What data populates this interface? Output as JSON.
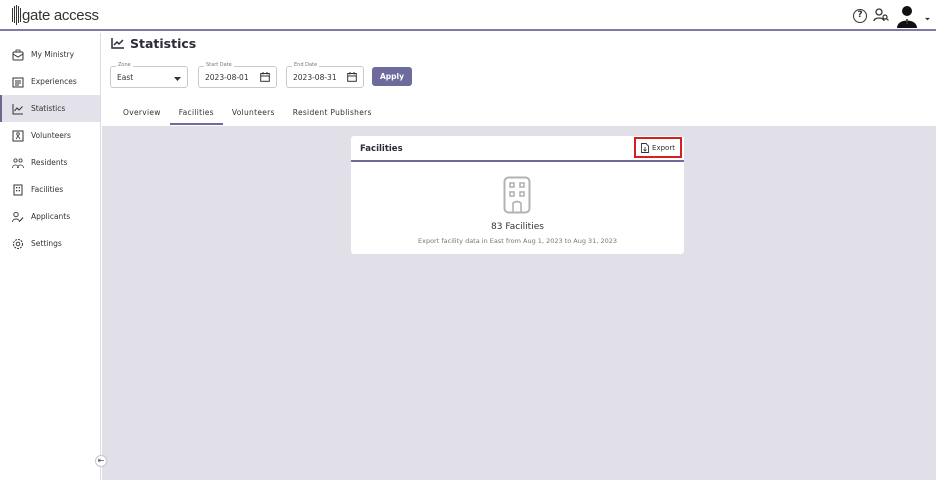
{
  "app": {
    "logo_text": "gate access"
  },
  "sidebar": {
    "items": [
      {
        "label": "My Ministry",
        "icon": "ministry-icon"
      },
      {
        "label": "Experiences",
        "icon": "experiences-icon"
      },
      {
        "label": "Statistics",
        "icon": "statistics-icon",
        "active": true
      },
      {
        "label": "Volunteers",
        "icon": "volunteers-icon"
      },
      {
        "label": "Residents",
        "icon": "residents-icon"
      },
      {
        "label": "Facilities",
        "icon": "facilities-icon"
      },
      {
        "label": "Applicants",
        "icon": "applicants-icon"
      },
      {
        "label": "Settings",
        "icon": "settings-icon"
      }
    ],
    "collapse_glyph": "⇤"
  },
  "page": {
    "title": "Statistics"
  },
  "filters": {
    "zone": {
      "label": "Zone",
      "value": "East"
    },
    "start_date": {
      "label": "Start Date",
      "value": "2023-08-01"
    },
    "end_date": {
      "label": "End Date",
      "value": "2023-08-31"
    },
    "apply_label": "Apply"
  },
  "tabs": [
    {
      "label": "Overview"
    },
    {
      "label": "Facilities",
      "active": true
    },
    {
      "label": "Volunteers"
    },
    {
      "label": "Resident Publishers"
    }
  ],
  "card": {
    "title": "Facilities",
    "export_label": "Export",
    "count_text": "83 Facilities",
    "description": "Export facility data in East from Aug 1, 2023 to Aug 31, 2023"
  },
  "colors": {
    "accent": "#6c6b9c",
    "highlight": "#d42020",
    "background": "#e1e0e8"
  }
}
